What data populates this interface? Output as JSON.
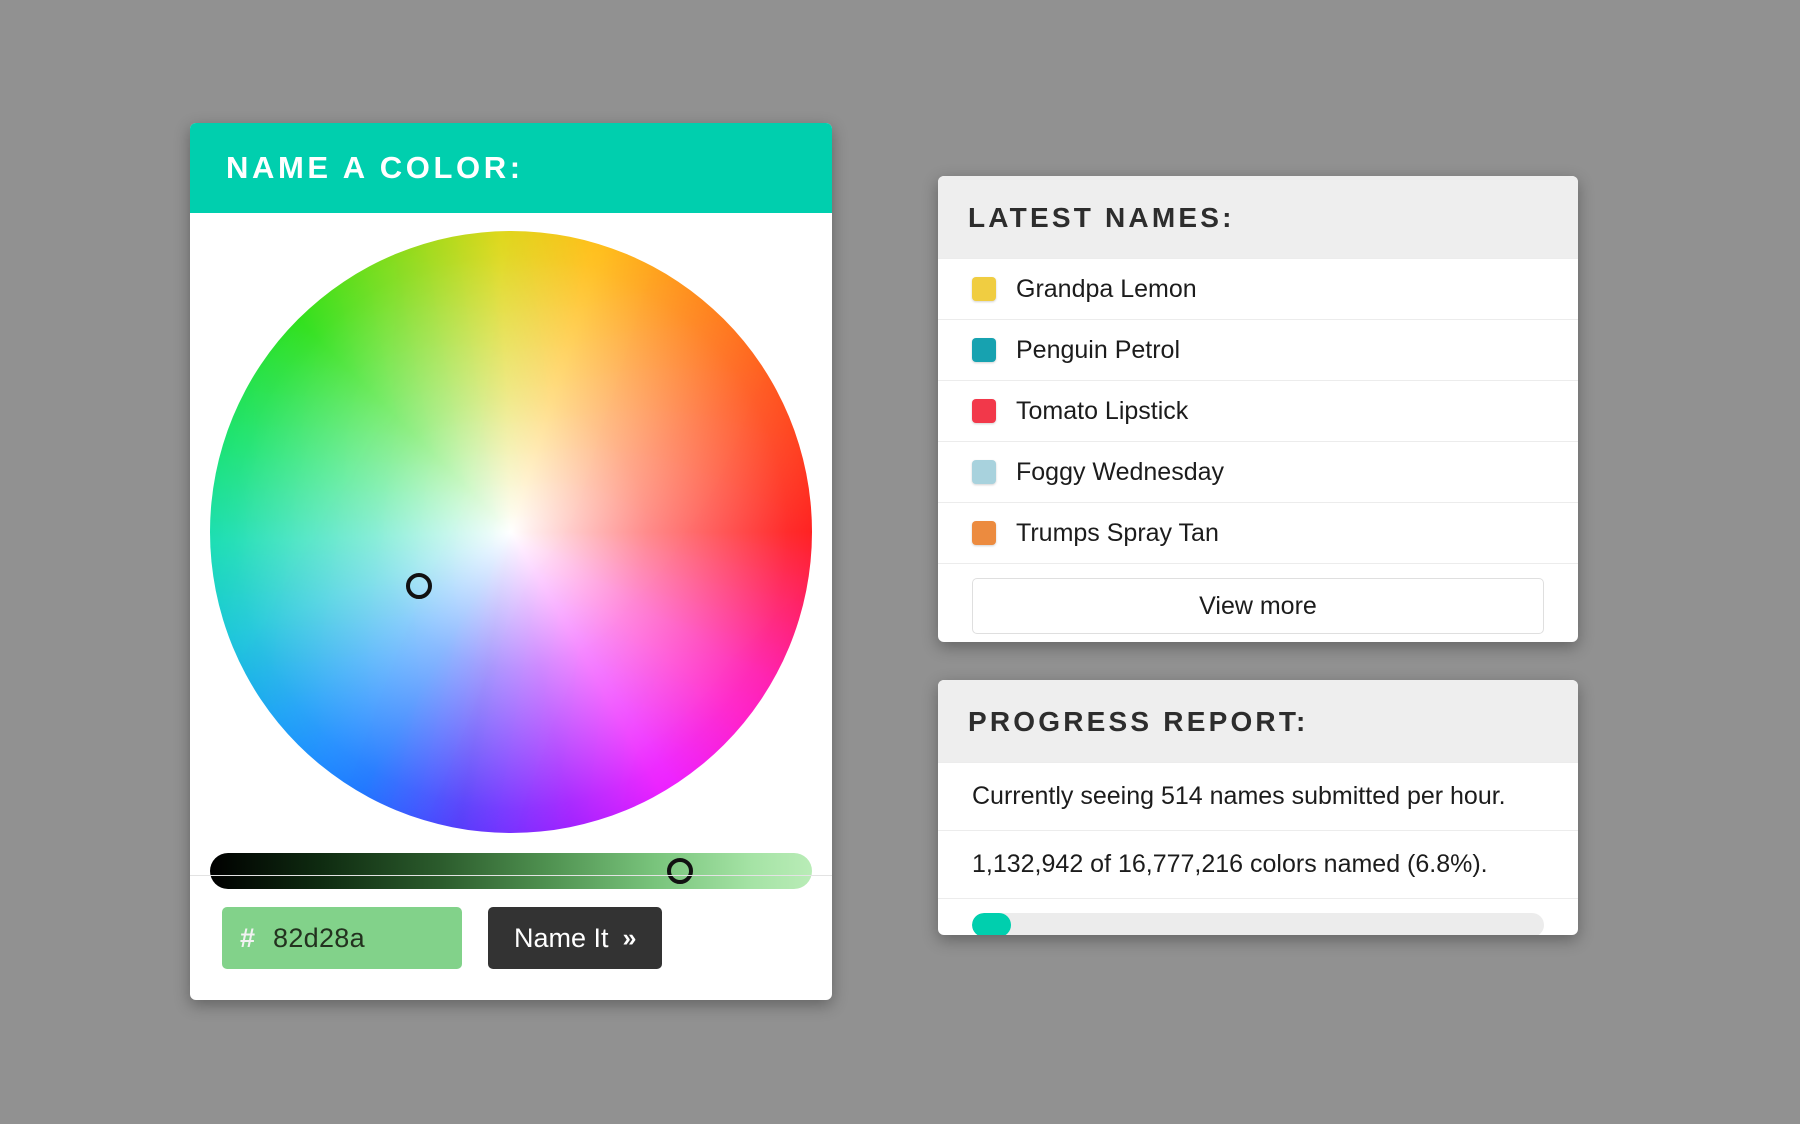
{
  "theme": {
    "page_background": "#919191",
    "accent": "#00cfae",
    "card_header_bg": "#eeeeee",
    "button_dark": "#333333"
  },
  "picker": {
    "header_title": "NAME A COLOR:",
    "wheel": {
      "icon": "color-wheel",
      "marker_icon": "wheel-marker-ring",
      "marker_x_pct": 34.8,
      "marker_y_pct": 59.0
    },
    "brightness": {
      "handle_icon": "slider-handle-ring",
      "value_pct": 78
    },
    "hex": {
      "hash_symbol": "#",
      "value": "82d28a",
      "placeholder": "82d28a",
      "swatch_color": "#82d28a"
    },
    "submit": {
      "label": "Name It",
      "chevron": "»",
      "icon": "double-chevron-right-icon"
    }
  },
  "latest": {
    "header_title": "LATEST NAMES:",
    "items": [
      {
        "label": "Grandpa Lemon",
        "color": "#f0cd41"
      },
      {
        "label": "Penguin Petrol",
        "color": "#17a2b0"
      },
      {
        "label": "Tomato Lipstick",
        "color": "#f2384a"
      },
      {
        "label": "Foggy Wednesday",
        "color": "#a8d2dd"
      },
      {
        "label": "Trumps Spray Tan",
        "color": "#ec8b3f"
      }
    ],
    "view_more_label": "View more"
  },
  "progress": {
    "header_title": "PROGRESS REPORT:",
    "rate_text": "Currently seeing 514 names submitted per hour.",
    "count_text": "1,132,942 of 16,777,216 colors named (6.8%).",
    "bar": {
      "percent": 6.8,
      "fill_color": "#00cfae",
      "track_color": "#ececec"
    }
  }
}
